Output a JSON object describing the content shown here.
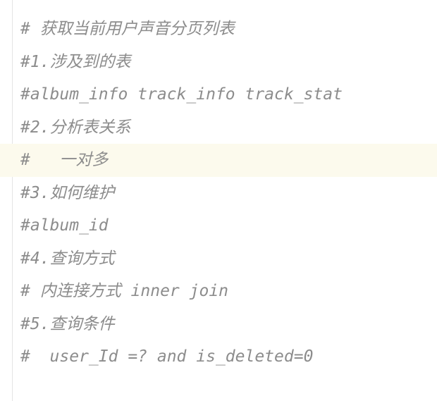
{
  "editor": {
    "lines": [
      "# 获取当前用户声音分页列表",
      "#1.涉及到的表",
      "#album_info track_info track_stat",
      "#2.分析表关系",
      "#   一对多",
      "#3.如何维护",
      "#album_id",
      "#4.查询方式",
      "# 内连接方式 inner join",
      "#5.查询条件",
      "#  user_Id =? and is_deleted=0"
    ],
    "current_line_index": 4,
    "colors": {
      "background": "#ffffff",
      "comment_text": "#8c8c8c",
      "current_line_highlight": "#fcfaed",
      "gutter_border": "#e4e4e4"
    }
  }
}
